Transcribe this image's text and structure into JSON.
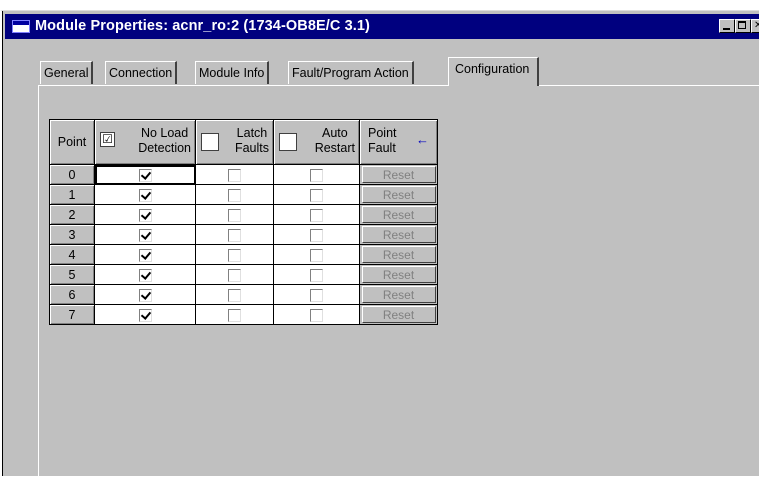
{
  "window": {
    "title": "Module Properties: acnr_ro:2 (1734-OB8E/C 3.1)"
  },
  "tabs": [
    {
      "label": "General"
    },
    {
      "label": "Connection"
    },
    {
      "label": "Module Info"
    },
    {
      "label": "Fault/Program Action"
    },
    {
      "label": "Configuration"
    }
  ],
  "active_tab": "Configuration",
  "table": {
    "headers": {
      "point": "Point",
      "no_load_1": "No Load",
      "no_load_2": "Detection",
      "latch_1": "Latch",
      "latch_2": "Faults",
      "auto_1": "Auto",
      "auto_2": "Restart",
      "pf_1": "Point",
      "pf_2": "Fault",
      "arrow": "←"
    },
    "rows": [
      {
        "point": "0",
        "no_load": true,
        "latch": false,
        "auto": false,
        "reset": "Reset"
      },
      {
        "point": "1",
        "no_load": true,
        "latch": false,
        "auto": false,
        "reset": "Reset"
      },
      {
        "point": "2",
        "no_load": true,
        "latch": false,
        "auto": false,
        "reset": "Reset"
      },
      {
        "point": "3",
        "no_load": true,
        "latch": false,
        "auto": false,
        "reset": "Reset"
      },
      {
        "point": "4",
        "no_load": true,
        "latch": false,
        "auto": false,
        "reset": "Reset"
      },
      {
        "point": "5",
        "no_load": true,
        "latch": false,
        "auto": false,
        "reset": "Reset"
      },
      {
        "point": "6",
        "no_load": true,
        "latch": false,
        "auto": false,
        "reset": "Reset"
      },
      {
        "point": "7",
        "no_load": true,
        "latch": false,
        "auto": false,
        "reset": "Reset"
      }
    ]
  }
}
